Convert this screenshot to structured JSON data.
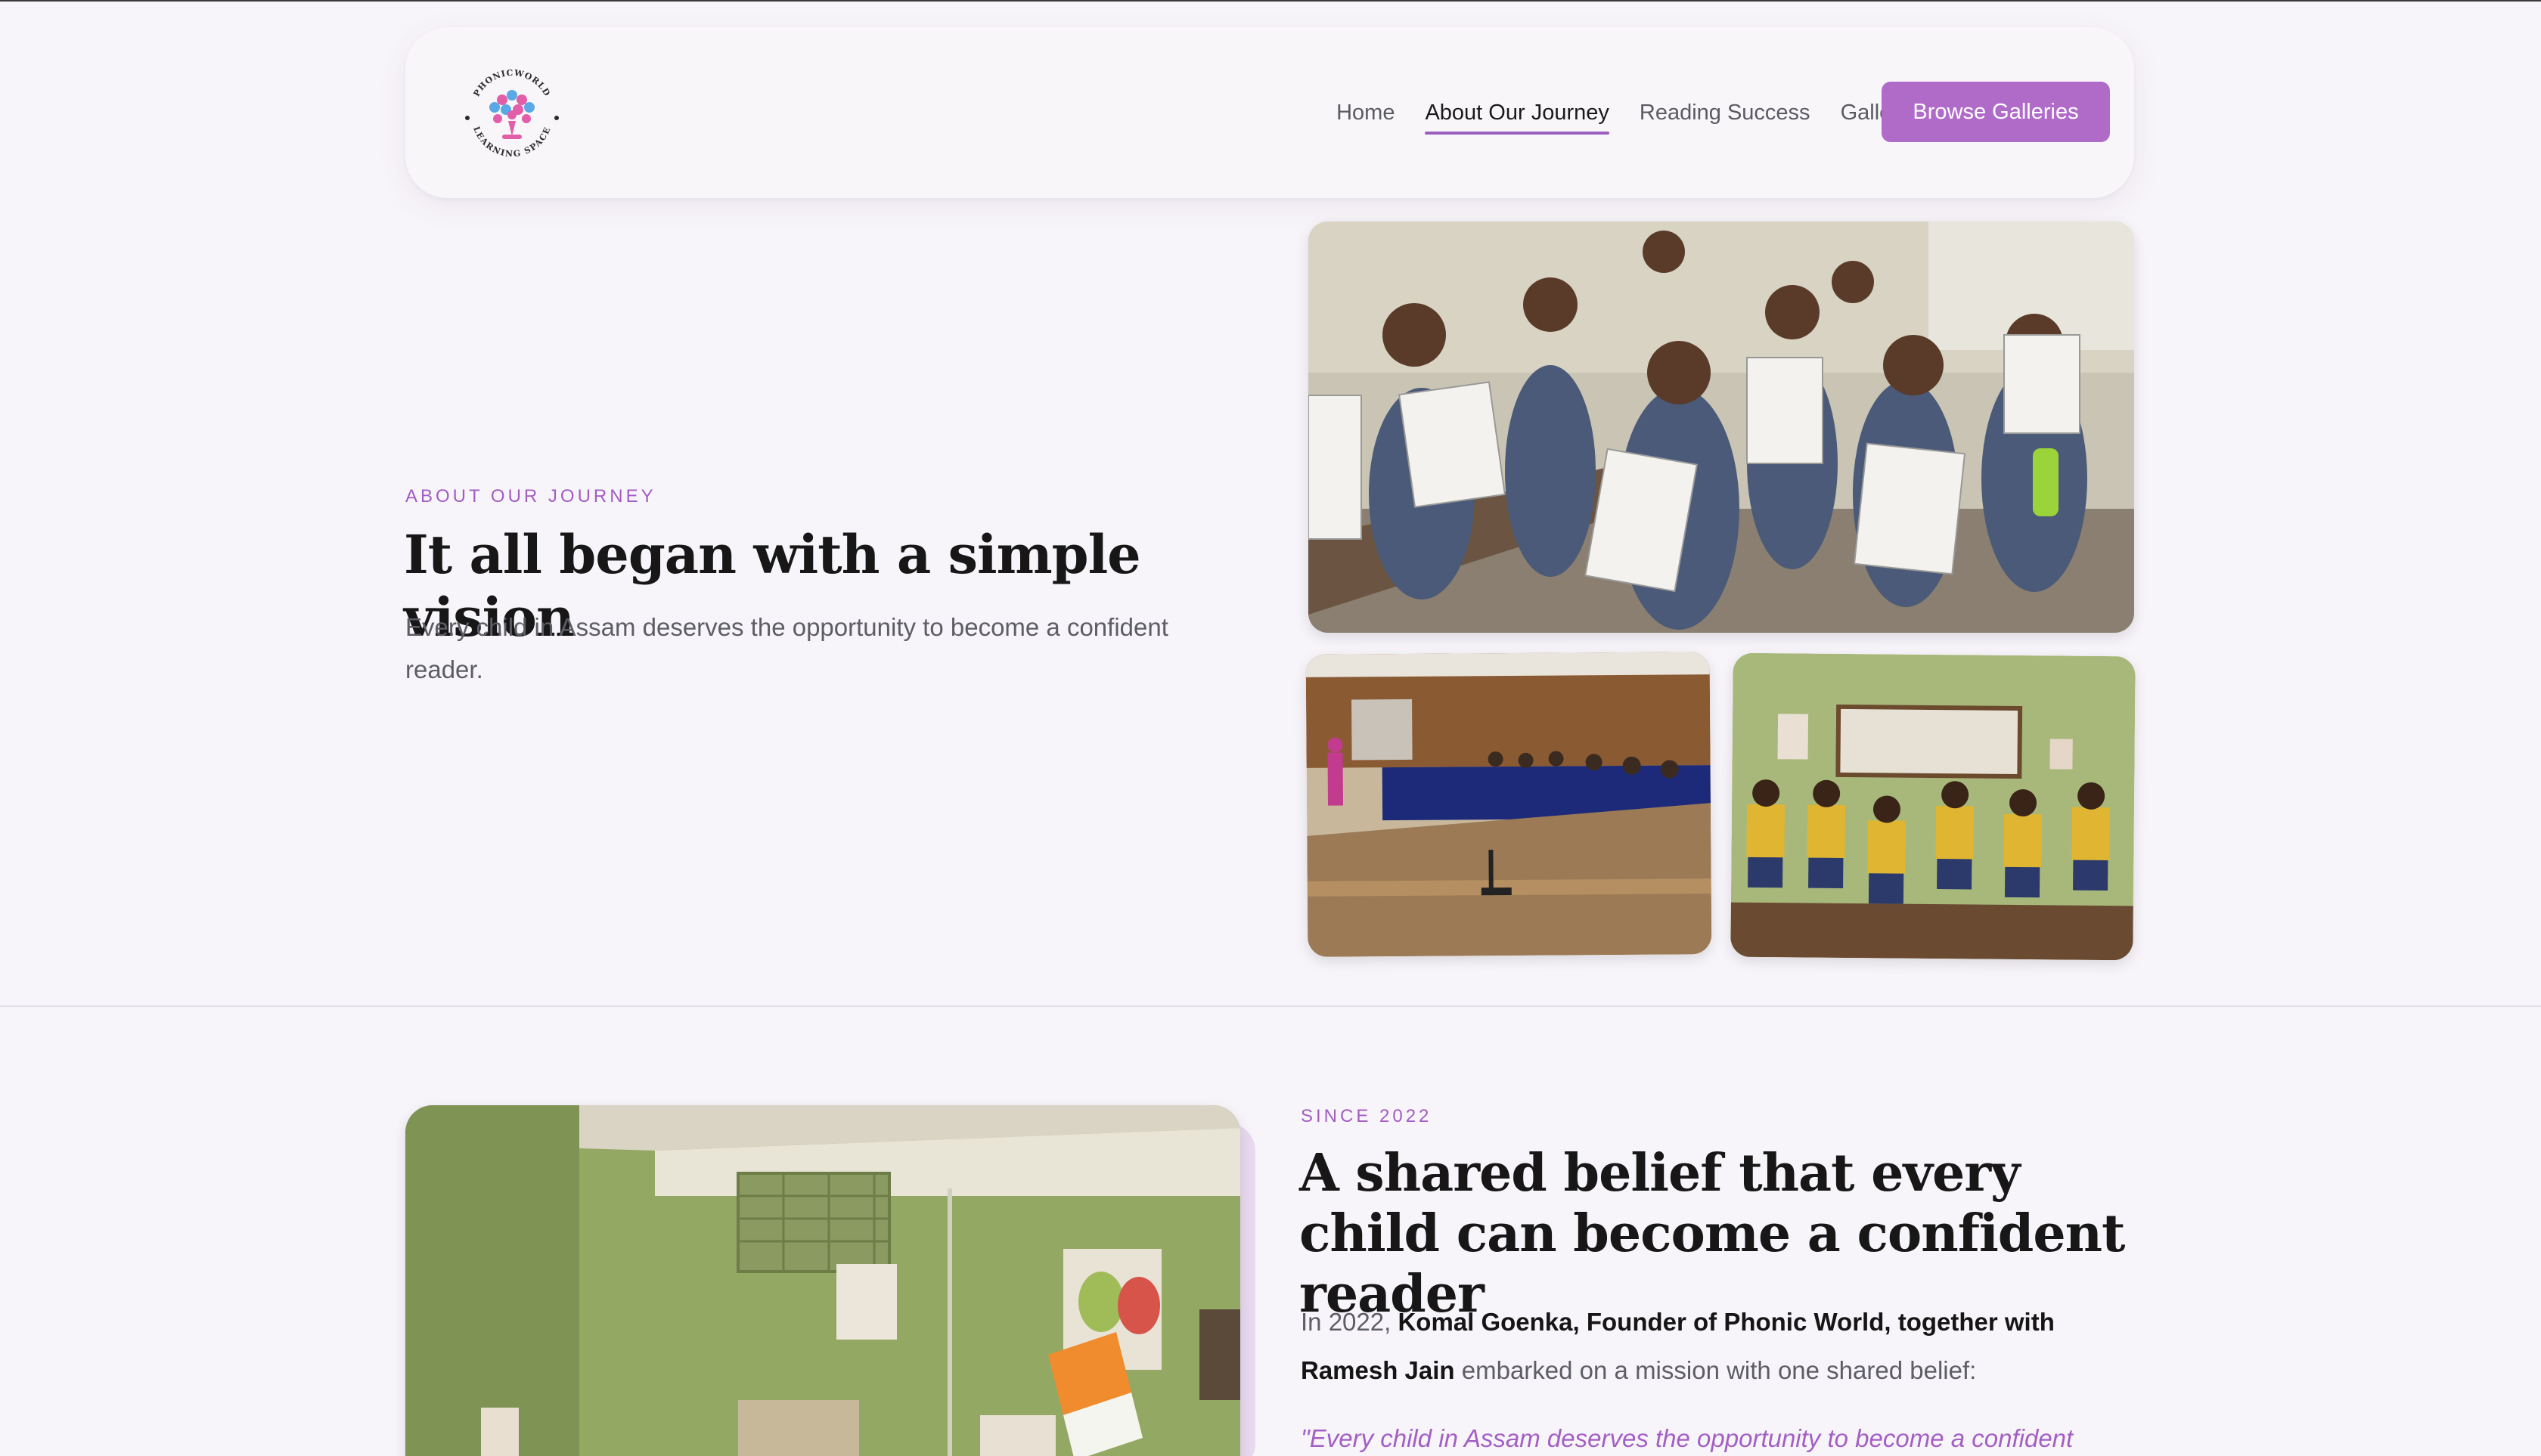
{
  "brand": {
    "logo_top_text": "PHONICWORLD",
    "logo_bottom_text": "LEARNING SPACE"
  },
  "nav": {
    "items": [
      {
        "label": "Home",
        "active": false
      },
      {
        "label": "About Our Journey",
        "active": true
      },
      {
        "label": "Reading Success",
        "active": false
      },
      {
        "label": "Galleries",
        "active": false
      }
    ],
    "cta_label": "Browse Galleries"
  },
  "hero": {
    "eyebrow": "ABOUT OUR JOURNEY",
    "title": "It all began with a simple vision",
    "body": "Every child in Assam deserves the opportunity to become a confident reader."
  },
  "section2": {
    "eyebrow": "SINCE 2022",
    "title": "A shared belief that every child can become a confident reader",
    "body_prefix": "In 2022, ",
    "body_bold": "Komal Goenka, Founder of Phonic World, together with Ramesh Jain",
    "body_suffix": " embarked on a mission with one shared belief:",
    "quote": "\"Every child in Assam deserves the opportunity to become a confident"
  },
  "colors": {
    "accent": "#b06bc9",
    "eyebrow": "#a25cc2",
    "background": "#f8f5fa"
  }
}
